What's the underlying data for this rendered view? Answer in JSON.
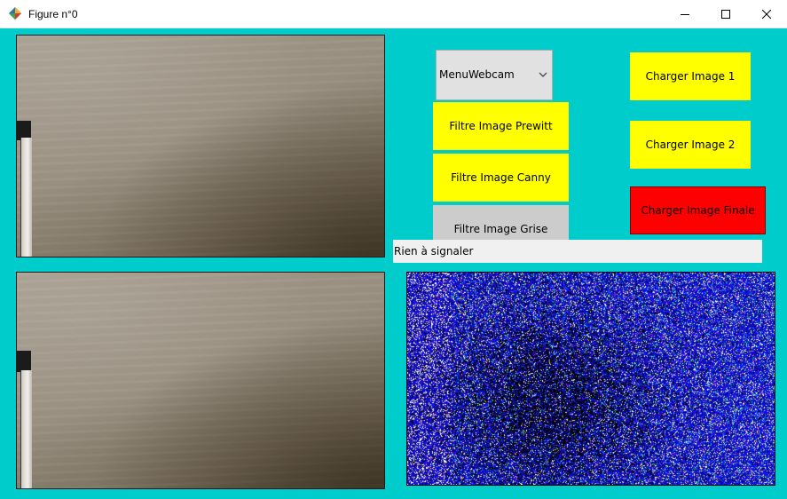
{
  "window": {
    "title": "Figure n°0"
  },
  "combo": {
    "value": "MenuWebcam"
  },
  "buttons": {
    "prewitt": "Filtre Image Prewitt",
    "canny": "Filtre Image Canny",
    "grise": "Filtre Image Grise",
    "charger1": "Charger Image 1",
    "charger2": "Charger Image 2",
    "finale": "Charger Image Finale"
  },
  "status": {
    "text": "Rien à signaler"
  },
  "colors": {
    "background": "#00cccc",
    "button_yellow": "#ffff00",
    "button_red": "#ff0000",
    "button_grey": "#cccccc"
  },
  "icons": [
    "app-icon",
    "minimize-icon",
    "maximize-icon",
    "close-icon",
    "chevron-down-icon"
  ]
}
